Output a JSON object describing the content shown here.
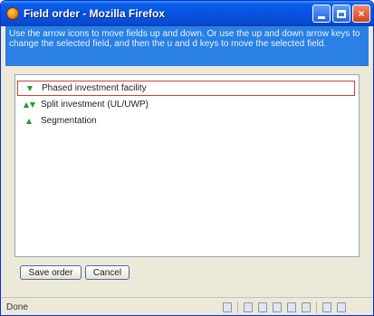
{
  "window": {
    "title": "Field order - Mozilla Firefox",
    "minimize_label": "",
    "maximize_label": "",
    "close_label": "×"
  },
  "instructions": "Use the arrow icons to move fields up and down. Or use the up and down arrow keys to change the selected field, and then the u and d keys to move the selected field.",
  "fields": [
    {
      "label": "Phased investment facility",
      "arrows": [
        "down"
      ],
      "selected": true
    },
    {
      "label": "Split investment (UL/UWP)",
      "arrows": [
        "up",
        "down"
      ],
      "selected": false
    },
    {
      "label": "Segmentation",
      "arrows": [
        "up"
      ],
      "selected": false
    }
  ],
  "buttons": {
    "save_label": "Save order",
    "cancel_label": "Cancel"
  },
  "status": {
    "text": "Done"
  },
  "colors": {
    "title_bar": "#0653e0",
    "instructions_bg": "#2a80e4",
    "arrow": "#1f9a2a",
    "selection_border": "#d23c3c"
  }
}
